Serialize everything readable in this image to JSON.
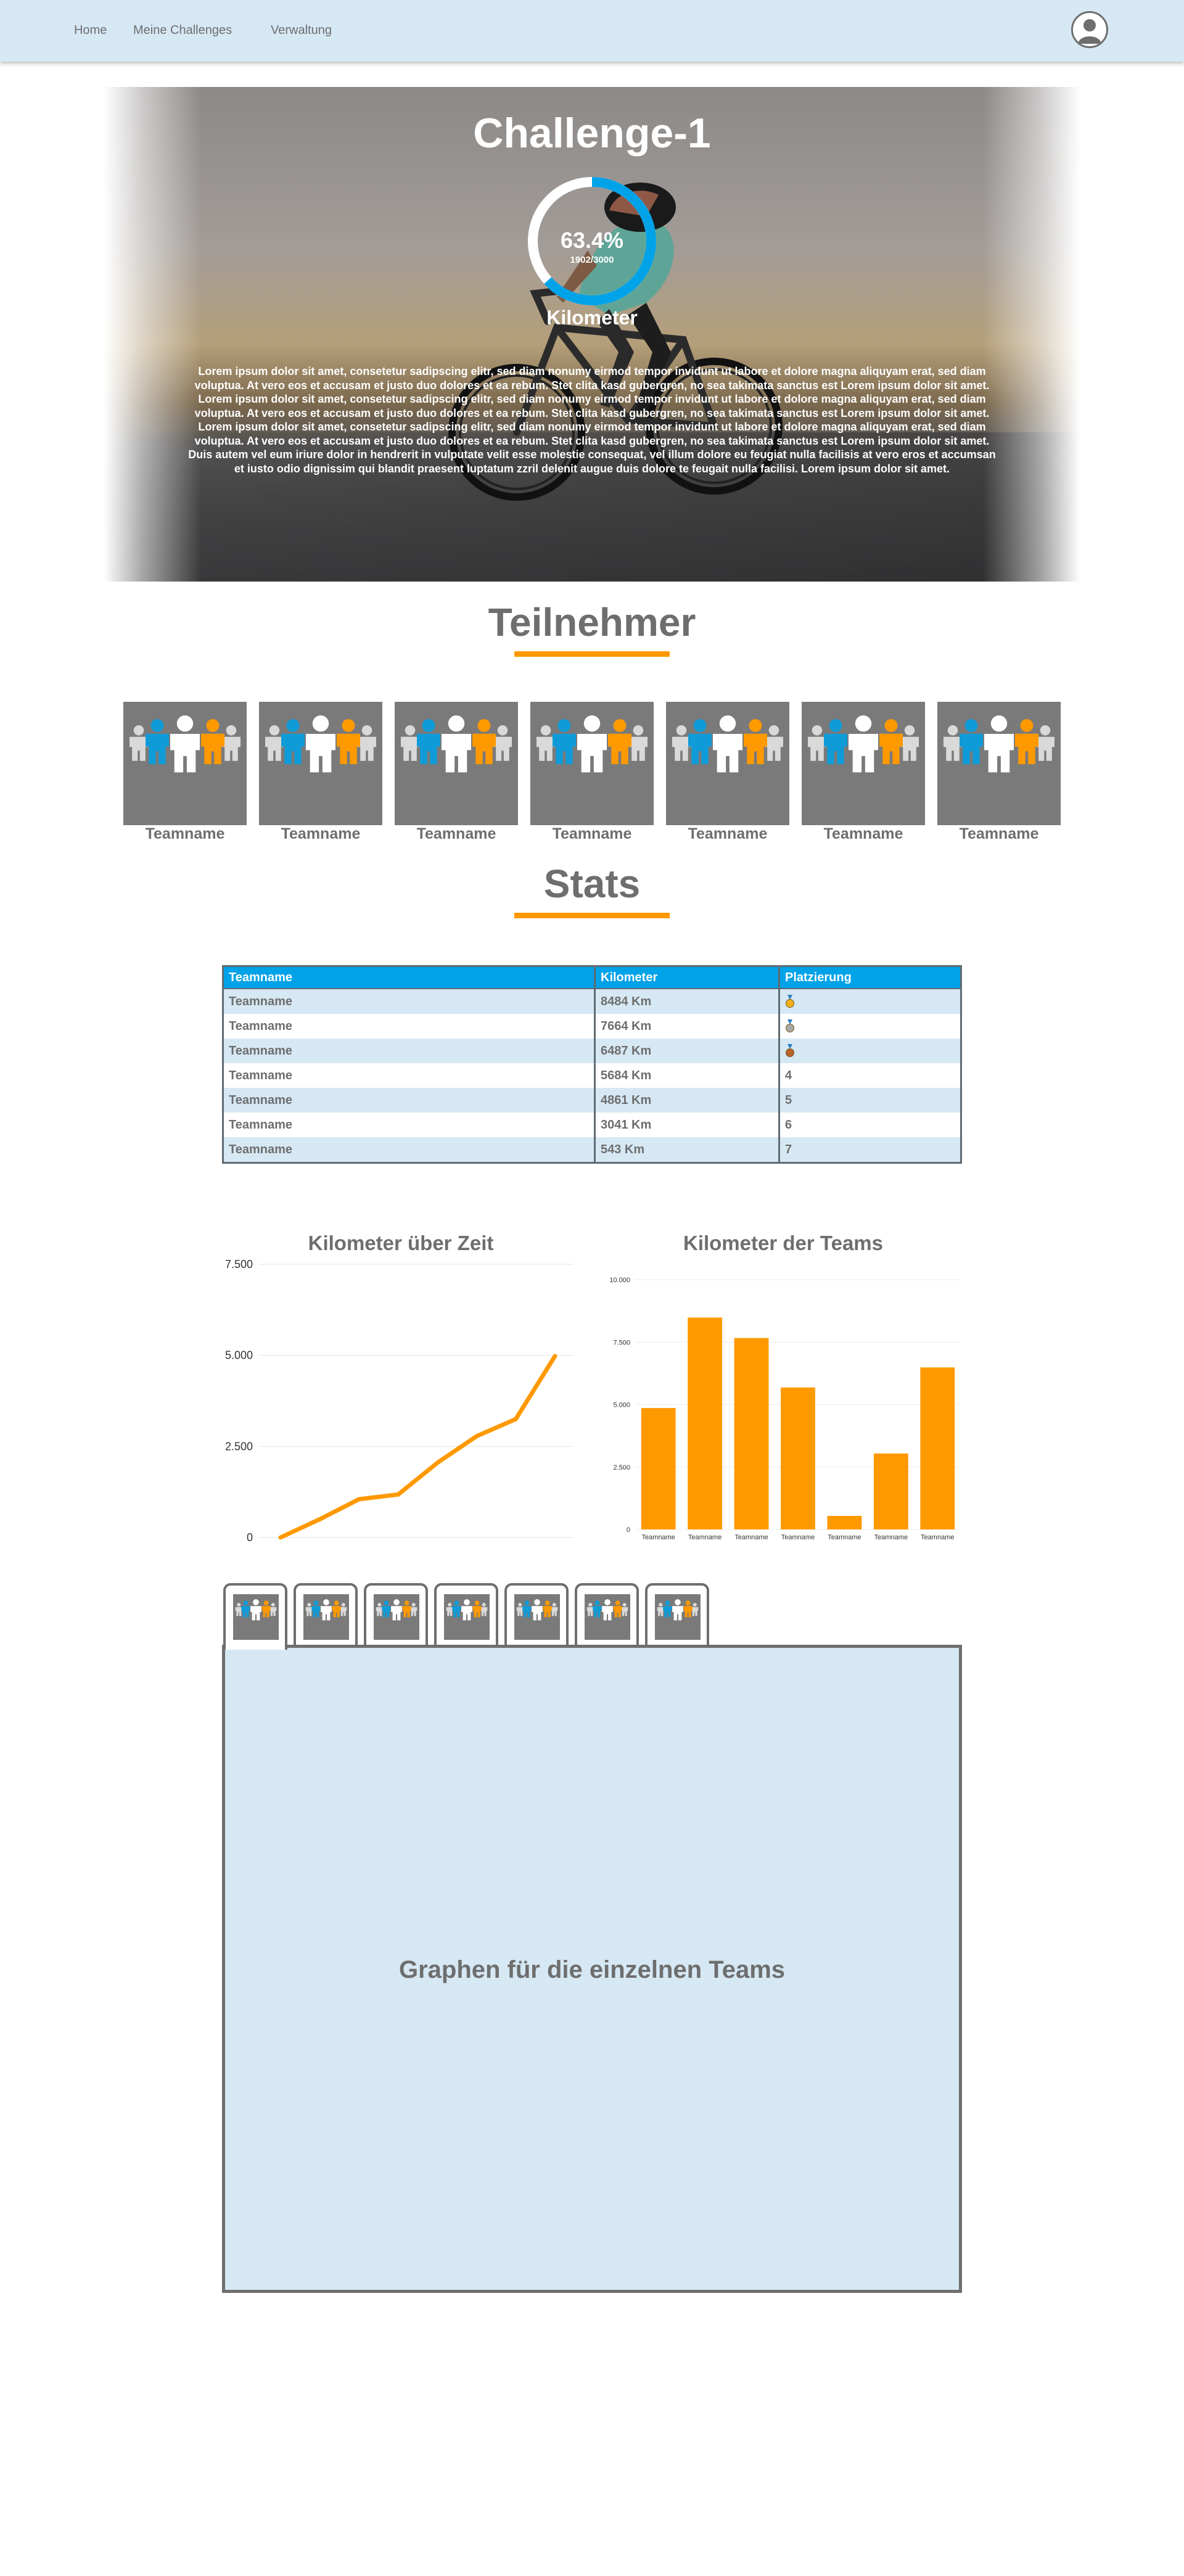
{
  "nav": {
    "links": [
      "Home",
      "Meine Challenges",
      "Verwaltung"
    ]
  },
  "hero": {
    "title": "Challenge-1",
    "progress_fraction": 0.634,
    "percent_text": "63.4%",
    "progress_text": "1902/3000",
    "unit": "Kilometer",
    "description": "Lorem ipsum dolor sit amet, consetetur sadipscing elitr, sed diam nonumy eirmod tempor invidunt ut labore et dolore magna aliquyam erat, sed diam voluptua. At vero eos et accusam et justo duo dolores et ea rebum. Stet clita kasd gubergren, no sea takimata sanctus est Lorem ipsum dolor sit amet. Lorem ipsum dolor sit amet, consetetur sadipscing elitr, sed diam nonumy eirmod tempor invidunt ut labore et dolore magna aliquyam erat, sed diam voluptua. At vero eos et accusam et justo duo dolores et ea rebum. Stet clita kasd gubergren, no sea takimata sanctus est Lorem ipsum dolor sit amet. Lorem ipsum dolor sit amet, consetetur sadipscing elitr, sed diam nonumy eirmod tempor invidunt ut labore et dolore magna aliquyam erat, sed diam voluptua. At vero eos et accusam et justo duo dolores et ea rebum. Stet clita kasd gubergren, no sea takimata sanctus est Lorem ipsum dolor sit amet.",
    "description2": "Duis autem vel eum iriure dolor in hendrerit in vulputate velit esse molestie consequat, vel illum dolore eu feugiat nulla facilisis at vero eros et accumsan et iusto odio dignissim qui blandit praesent luptatum zzril delenit augue duis dolore te feugait nulla facilisi. Lorem ipsum dolor sit amet."
  },
  "teams_section": {
    "title": "Teilnehmer",
    "teams": [
      "Teamname",
      "Teamname",
      "Teamname",
      "Teamname",
      "Teamname",
      "Teamname",
      "Teamname"
    ]
  },
  "stats_section": {
    "title": "Stats",
    "columns": [
      "Teamname",
      "Kilometer",
      "Platzierung"
    ],
    "rows": [
      {
        "team": "Teamname",
        "km": "8484 Km",
        "place": "",
        "medal": "gold"
      },
      {
        "team": "Teamname",
        "km": "7664 Km",
        "place": "",
        "medal": "silver"
      },
      {
        "team": "Teamname",
        "km": "6487 Km",
        "place": "",
        "medal": "bronze"
      },
      {
        "team": "Teamname",
        "km": "5684 Km",
        "place": "4",
        "medal": ""
      },
      {
        "team": "Teamname",
        "km": "4861 Km",
        "place": "5",
        "medal": ""
      },
      {
        "team": "Teamname",
        "km": "3041 Km",
        "place": "6",
        "medal": ""
      },
      {
        "team": "Teamname",
        "km": "543 Km",
        "place": "7",
        "medal": ""
      }
    ]
  },
  "colors": {
    "accent_orange": "#ff9900",
    "accent_blue": "#00a2e8",
    "light_blue": "#d6e8f4",
    "text_gray": "#6e6e6e"
  },
  "chart_data": [
    {
      "type": "line",
      "title": "Kilometer über Zeit",
      "xlabel": "",
      "ylabel": "",
      "x": [
        0,
        1,
        2,
        3,
        4,
        5,
        6,
        7
      ],
      "series": [
        {
          "values": [
            0,
            500,
            1050,
            1180,
            2050,
            2780,
            3250,
            4980
          ]
        }
      ],
      "yticks": [
        "0",
        "2.500",
        "5.000",
        "7.500"
      ],
      "ylim": [
        0,
        7500
      ],
      "grid": true,
      "color": "#ff9900"
    },
    {
      "type": "bar",
      "title": "Kilometer der Teams",
      "xlabel": "",
      "ylabel": "",
      "categories": [
        "Teamname",
        "Teamname",
        "Teamname",
        "Teamname",
        "Teamname",
        "Teamname",
        "Teamname"
      ],
      "values": [
        4861,
        8484,
        7664,
        5684,
        543,
        3041,
        6487
      ],
      "yticks": [
        "0",
        "2.500",
        "5.000",
        "7.500",
        "10.000"
      ],
      "ylim": [
        0,
        10000
      ],
      "grid": true,
      "color": "#ff9900"
    }
  ],
  "team_panel": {
    "tab_count": 7,
    "placeholder": "Graphen für die einzelnen Teams"
  }
}
